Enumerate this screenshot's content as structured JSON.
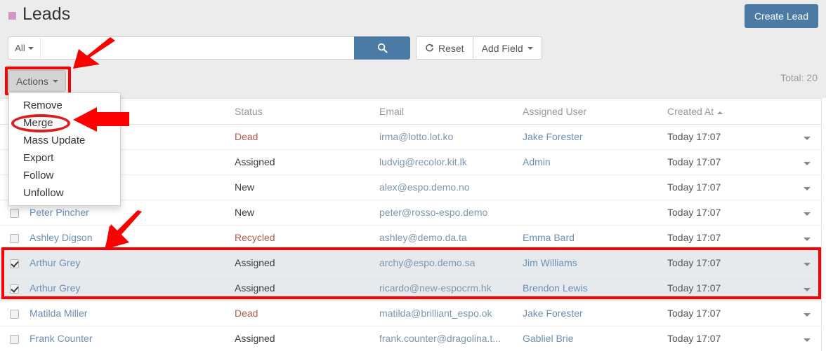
{
  "header": {
    "title": "Leads",
    "title_square_color": "#d696c4",
    "create_button": "Create Lead"
  },
  "search": {
    "scope_label": "All",
    "input_value": "",
    "placeholder": "",
    "search_icon": "magnifier-icon",
    "reset_label": "Reset",
    "reset_icon": "refresh-icon",
    "add_field_label": "Add Field"
  },
  "toolbar": {
    "actions_label": "Actions",
    "total_label": "Total: 20"
  },
  "actions_menu": {
    "items": [
      {
        "label": "Remove"
      },
      {
        "label": "Merge"
      },
      {
        "label": "Mass Update"
      },
      {
        "label": "Export"
      },
      {
        "label": "Follow"
      },
      {
        "label": "Unfollow"
      }
    ]
  },
  "table": {
    "columns": [
      {
        "key": "checkbox",
        "label": ""
      },
      {
        "key": "name",
        "label": ""
      },
      {
        "key": "status",
        "label": "Status"
      },
      {
        "key": "email",
        "label": "Email"
      },
      {
        "key": "user",
        "label": "Assigned User"
      },
      {
        "key": "date",
        "label": "Created At"
      },
      {
        "key": "menu",
        "label": ""
      }
    ],
    "sorted_column": "Created At",
    "sort_direction": "asc",
    "rows": [
      {
        "checked": false,
        "name": "",
        "status": "Dead",
        "status_kind": "dead",
        "email": "irma@lotto.lot.ko",
        "user": "Jake Forester",
        "date": "Today 17:07",
        "selected": false
      },
      {
        "checked": false,
        "name": "",
        "status": "Assigned",
        "status_kind": "plain",
        "email": "ludvig@recolor.kit.lk",
        "user": "Admin",
        "date": "Today 17:07",
        "selected": false
      },
      {
        "checked": false,
        "name": "",
        "status": "New",
        "status_kind": "plain",
        "email": "alex@espo.demo.no",
        "user": "",
        "date": "Today 17:07",
        "selected": false
      },
      {
        "checked": false,
        "name": "Peter Pincher",
        "status": "New",
        "status_kind": "plain",
        "email": "peter@rosso-espo.demo",
        "user": "",
        "date": "Today 17:07",
        "selected": false
      },
      {
        "checked": false,
        "name": "Ashley Digson",
        "status": "Recycled",
        "status_kind": "recycled",
        "email": "ashley@demo.da.ta",
        "user": "Emma Bard",
        "date": "Today 17:07",
        "selected": false
      },
      {
        "checked": true,
        "name": "Arthur Grey",
        "status": "Assigned",
        "status_kind": "plain",
        "email": "archy@espo.demo.sa",
        "user": "Jim Williams",
        "date": "Today 17:07",
        "selected": true
      },
      {
        "checked": true,
        "name": "Arthur Grey",
        "status": "Assigned",
        "status_kind": "plain",
        "email": "ricardo@new-espocrm.hk",
        "user": "Brendon Lewis",
        "date": "Today 17:07",
        "selected": true
      },
      {
        "checked": false,
        "name": "Matilda Miller",
        "status": "Dead",
        "status_kind": "dead",
        "email": "matilda@brilliant_espo.ok",
        "user": "Jake Forester",
        "date": "Today 17:07",
        "selected": false
      },
      {
        "checked": false,
        "name": "Frank Counter",
        "status": "Assigned",
        "status_kind": "plain",
        "email": "frank.counter@dragolina.t...",
        "user": "Gabliel Brie",
        "date": "Today 17:07",
        "selected": false
      }
    ]
  },
  "annotations": {
    "highlight_color": "#fb0000",
    "arrow_to_actions": "red-arrow-pointing-to-actions-button",
    "arrow_to_merge": "red-arrow-pointing-to-merge-item",
    "arrow_to_selected_rows": "red-arrow-pointing-to-selected-rows",
    "ellipse_on_merge": "red-ellipse-around-merge",
    "box_on_actions": "red-box-around-actions-button",
    "box_on_selected_rows": "red-box-around-selected-rows"
  }
}
